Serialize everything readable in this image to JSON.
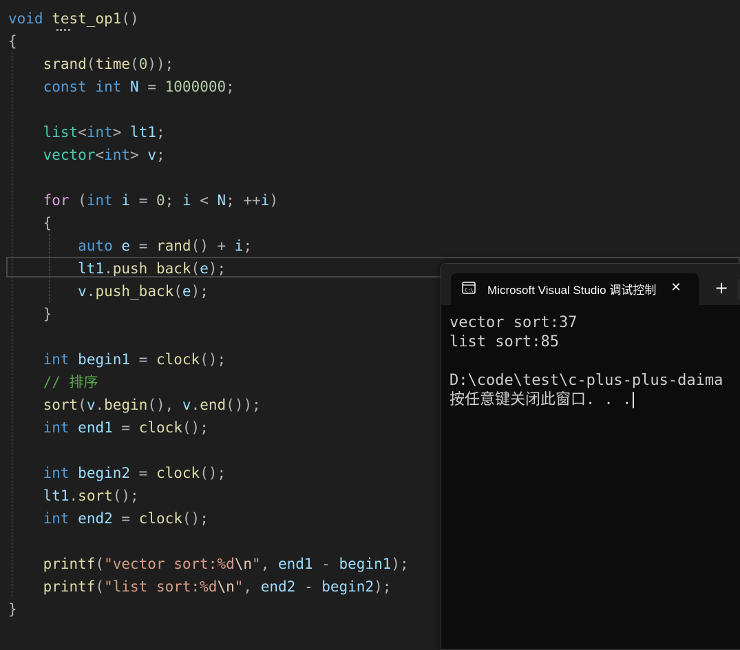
{
  "editor": {
    "lines": [
      [
        {
          "t": "void",
          "c": "kw"
        },
        {
          "t": " ",
          "c": "nm"
        },
        {
          "t": "test_op1",
          "c": "fn"
        },
        {
          "t": "()",
          "c": "pn"
        }
      ],
      [
        {
          "t": "{",
          "c": "pn"
        }
      ],
      [
        {
          "t": "    ",
          "c": "nm"
        },
        {
          "t": "srand",
          "c": "fn"
        },
        {
          "t": "(",
          "c": "pn"
        },
        {
          "t": "time",
          "c": "fn"
        },
        {
          "t": "(",
          "c": "pn"
        },
        {
          "t": "0",
          "c": "num"
        },
        {
          "t": "));",
          "c": "pn"
        }
      ],
      [
        {
          "t": "    ",
          "c": "nm"
        },
        {
          "t": "const",
          "c": "kw"
        },
        {
          "t": " ",
          "c": "nm"
        },
        {
          "t": "int",
          "c": "kw"
        },
        {
          "t": " ",
          "c": "nm"
        },
        {
          "t": "N",
          "c": "var"
        },
        {
          "t": " = ",
          "c": "pn"
        },
        {
          "t": "1000000",
          "c": "num"
        },
        {
          "t": ";",
          "c": "pn"
        }
      ],
      [],
      [
        {
          "t": "    ",
          "c": "nm"
        },
        {
          "t": "list",
          "c": "ty"
        },
        {
          "t": "<",
          "c": "pn"
        },
        {
          "t": "int",
          "c": "kw"
        },
        {
          "t": ">",
          "c": "pn"
        },
        {
          "t": " ",
          "c": "nm"
        },
        {
          "t": "lt1",
          "c": "var"
        },
        {
          "t": ";",
          "c": "pn"
        }
      ],
      [
        {
          "t": "    ",
          "c": "nm"
        },
        {
          "t": "vector",
          "c": "ty"
        },
        {
          "t": "<",
          "c": "pn"
        },
        {
          "t": "int",
          "c": "kw"
        },
        {
          "t": ">",
          "c": "pn"
        },
        {
          "t": " ",
          "c": "nm"
        },
        {
          "t": "v",
          "c": "var"
        },
        {
          "t": ";",
          "c": "pn"
        }
      ],
      [],
      [
        {
          "t": "    ",
          "c": "nm"
        },
        {
          "t": "for",
          "c": "ctl"
        },
        {
          "t": " (",
          "c": "pn"
        },
        {
          "t": "int",
          "c": "kw"
        },
        {
          "t": " ",
          "c": "nm"
        },
        {
          "t": "i",
          "c": "var"
        },
        {
          "t": " = ",
          "c": "pn"
        },
        {
          "t": "0",
          "c": "num"
        },
        {
          "t": "; ",
          "c": "pn"
        },
        {
          "t": "i",
          "c": "var"
        },
        {
          "t": " < ",
          "c": "pn"
        },
        {
          "t": "N",
          "c": "var"
        },
        {
          "t": "; ++",
          "c": "pn"
        },
        {
          "t": "i",
          "c": "var"
        },
        {
          "t": ")",
          "c": "pn"
        }
      ],
      [
        {
          "t": "    ",
          "c": "nm"
        },
        {
          "t": "{",
          "c": "pn"
        }
      ],
      [
        {
          "t": "        ",
          "c": "nm"
        },
        {
          "t": "auto",
          "c": "kw"
        },
        {
          "t": " ",
          "c": "nm"
        },
        {
          "t": "e",
          "c": "var"
        },
        {
          "t": " = ",
          "c": "pn"
        },
        {
          "t": "rand",
          "c": "fn"
        },
        {
          "t": "() + ",
          "c": "pn"
        },
        {
          "t": "i",
          "c": "var"
        },
        {
          "t": ";",
          "c": "pn"
        }
      ],
      [
        {
          "t": "        ",
          "c": "nm"
        },
        {
          "t": "lt1",
          "c": "var"
        },
        {
          "t": ".",
          "c": "pn"
        },
        {
          "t": "push_back",
          "c": "fn"
        },
        {
          "t": "(",
          "c": "pn"
        },
        {
          "t": "e",
          "c": "var"
        },
        {
          "t": ");",
          "c": "pn"
        }
      ],
      [
        {
          "t": "        ",
          "c": "nm"
        },
        {
          "t": "v",
          "c": "var"
        },
        {
          "t": ".",
          "c": "pn"
        },
        {
          "t": "push_back",
          "c": "fn"
        },
        {
          "t": "(",
          "c": "pn"
        },
        {
          "t": "e",
          "c": "var"
        },
        {
          "t": ");",
          "c": "pn"
        }
      ],
      [
        {
          "t": "    ",
          "c": "nm"
        },
        {
          "t": "}",
          "c": "pn"
        }
      ],
      [],
      [
        {
          "t": "    ",
          "c": "nm"
        },
        {
          "t": "int",
          "c": "kw"
        },
        {
          "t": " ",
          "c": "nm"
        },
        {
          "t": "begin1",
          "c": "var"
        },
        {
          "t": " = ",
          "c": "pn"
        },
        {
          "t": "clock",
          "c": "fn"
        },
        {
          "t": "();",
          "c": "pn"
        }
      ],
      [
        {
          "t": "    ",
          "c": "nm"
        },
        {
          "t": "// 排序",
          "c": "cmt"
        }
      ],
      [
        {
          "t": "    ",
          "c": "nm"
        },
        {
          "t": "sort",
          "c": "fn"
        },
        {
          "t": "(",
          "c": "pn"
        },
        {
          "t": "v",
          "c": "var"
        },
        {
          "t": ".",
          "c": "pn"
        },
        {
          "t": "begin",
          "c": "fn"
        },
        {
          "t": "(), ",
          "c": "pn"
        },
        {
          "t": "v",
          "c": "var"
        },
        {
          "t": ".",
          "c": "pn"
        },
        {
          "t": "end",
          "c": "fn"
        },
        {
          "t": "());",
          "c": "pn"
        }
      ],
      [
        {
          "t": "    ",
          "c": "nm"
        },
        {
          "t": "int",
          "c": "kw"
        },
        {
          "t": " ",
          "c": "nm"
        },
        {
          "t": "end1",
          "c": "var"
        },
        {
          "t": " = ",
          "c": "pn"
        },
        {
          "t": "clock",
          "c": "fn"
        },
        {
          "t": "();",
          "c": "pn"
        }
      ],
      [],
      [
        {
          "t": "    ",
          "c": "nm"
        },
        {
          "t": "int",
          "c": "kw"
        },
        {
          "t": " ",
          "c": "nm"
        },
        {
          "t": "begin2",
          "c": "var"
        },
        {
          "t": " = ",
          "c": "pn"
        },
        {
          "t": "clock",
          "c": "fn"
        },
        {
          "t": "();",
          "c": "pn"
        }
      ],
      [
        {
          "t": "    ",
          "c": "nm"
        },
        {
          "t": "lt1",
          "c": "var"
        },
        {
          "t": ".",
          "c": "pn"
        },
        {
          "t": "sort",
          "c": "fn"
        },
        {
          "t": "();",
          "c": "pn"
        }
      ],
      [
        {
          "t": "    ",
          "c": "nm"
        },
        {
          "t": "int",
          "c": "kw"
        },
        {
          "t": " ",
          "c": "nm"
        },
        {
          "t": "end2",
          "c": "var"
        },
        {
          "t": " = ",
          "c": "pn"
        },
        {
          "t": "clock",
          "c": "fn"
        },
        {
          "t": "();",
          "c": "pn"
        }
      ],
      [],
      [
        {
          "t": "    ",
          "c": "nm"
        },
        {
          "t": "printf",
          "c": "fn"
        },
        {
          "t": "(",
          "c": "pn"
        },
        {
          "t": "\"vector sort:%d",
          "c": "str"
        },
        {
          "t": "\\n",
          "c": "esc"
        },
        {
          "t": "\"",
          "c": "str"
        },
        {
          "t": ", ",
          "c": "pn"
        },
        {
          "t": "end1",
          "c": "var"
        },
        {
          "t": " - ",
          "c": "pn"
        },
        {
          "t": "begin1",
          "c": "var"
        },
        {
          "t": ");",
          "c": "pn"
        }
      ],
      [
        {
          "t": "    ",
          "c": "nm"
        },
        {
          "t": "printf",
          "c": "fn"
        },
        {
          "t": "(",
          "c": "pn"
        },
        {
          "t": "\"list sort:%d",
          "c": "str"
        },
        {
          "t": "\\n",
          "c": "esc"
        },
        {
          "t": "\"",
          "c": "str"
        },
        {
          "t": ", ",
          "c": "pn"
        },
        {
          "t": "end2",
          "c": "var"
        },
        {
          "t": " - ",
          "c": "pn"
        },
        {
          "t": "begin2",
          "c": "var"
        },
        {
          "t": ");",
          "c": "pn"
        }
      ],
      [
        {
          "t": "}",
          "c": "pn"
        }
      ]
    ]
  },
  "console": {
    "tab_title": "Microsoft Visual Studio 调试控制台",
    "tab_icon": "terminal-icon",
    "close_glyph": "✕",
    "new_tab_glyph": "+",
    "output": [
      "vector sort:37",
      "list sort:85",
      "",
      "D:\\code\\test\\c-plus-plus-daima",
      "按任意键关闭此窗口. . ."
    ]
  }
}
